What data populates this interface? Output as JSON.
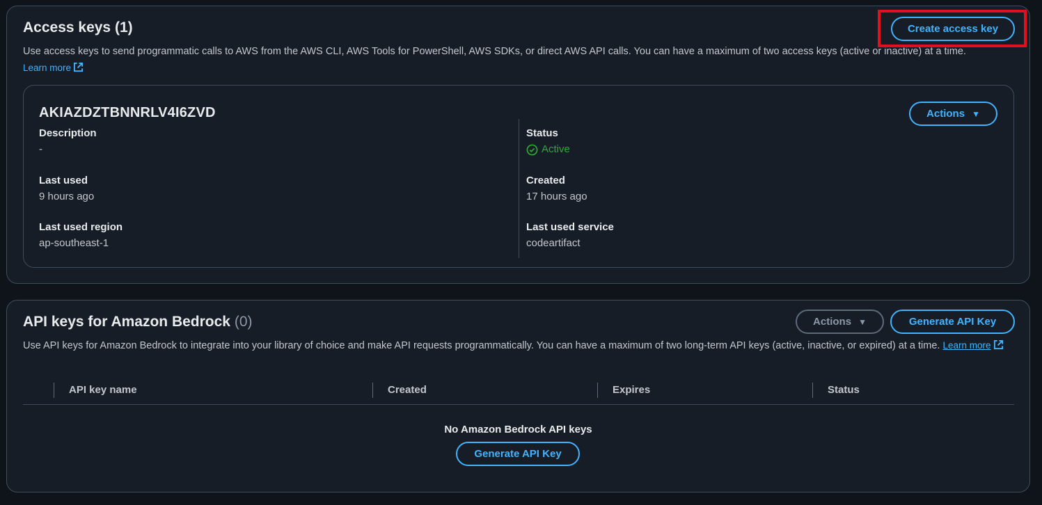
{
  "access_keys": {
    "title": "Access keys",
    "count": "(1)",
    "create_label": "Create access key",
    "description": "Use access keys to send programmatic calls to AWS from the AWS CLI, AWS Tools for PowerShell, AWS SDKs, or direct AWS API calls. You can have a maximum of two access keys (active or inactive) at a time.",
    "learn_more": "Learn more",
    "key": {
      "id": "AKIAZDZTBNNRLV4I6ZVD",
      "actions_label": "Actions",
      "fields": {
        "description_label": "Description",
        "description_value": "-",
        "last_used_label": "Last used",
        "last_used_value": "9 hours ago",
        "last_used_region_label": "Last used region",
        "last_used_region_value": "ap-southeast-1",
        "status_label": "Status",
        "status_value": "Active",
        "created_label": "Created",
        "created_value": "17 hours ago",
        "last_used_service_label": "Last used service",
        "last_used_service_value": "codeartifact"
      }
    }
  },
  "bedrock": {
    "title": "API keys for Amazon Bedrock",
    "count": "(0)",
    "actions_label": "Actions",
    "generate_label": "Generate API Key",
    "description": "Use API keys for Amazon Bedrock to integrate into your library of choice and make API requests programmatically. You can have a maximum of two long-term API keys (active, inactive, or expired) at a time.",
    "learn_more": "Learn more",
    "table": {
      "columns": [
        "API key name",
        "Created",
        "Expires",
        "Status"
      ]
    },
    "empty": {
      "title": "No Amazon Bedrock API keys",
      "button_label": "Generate API Key"
    }
  },
  "colors": {
    "accent": "#42b4ff",
    "active": "#29ad32",
    "highlight": "#e0101f"
  },
  "icons": {
    "external_link": "external-link-icon",
    "status_ok": "check-circle-icon",
    "dropdown": "caret-down-icon"
  }
}
